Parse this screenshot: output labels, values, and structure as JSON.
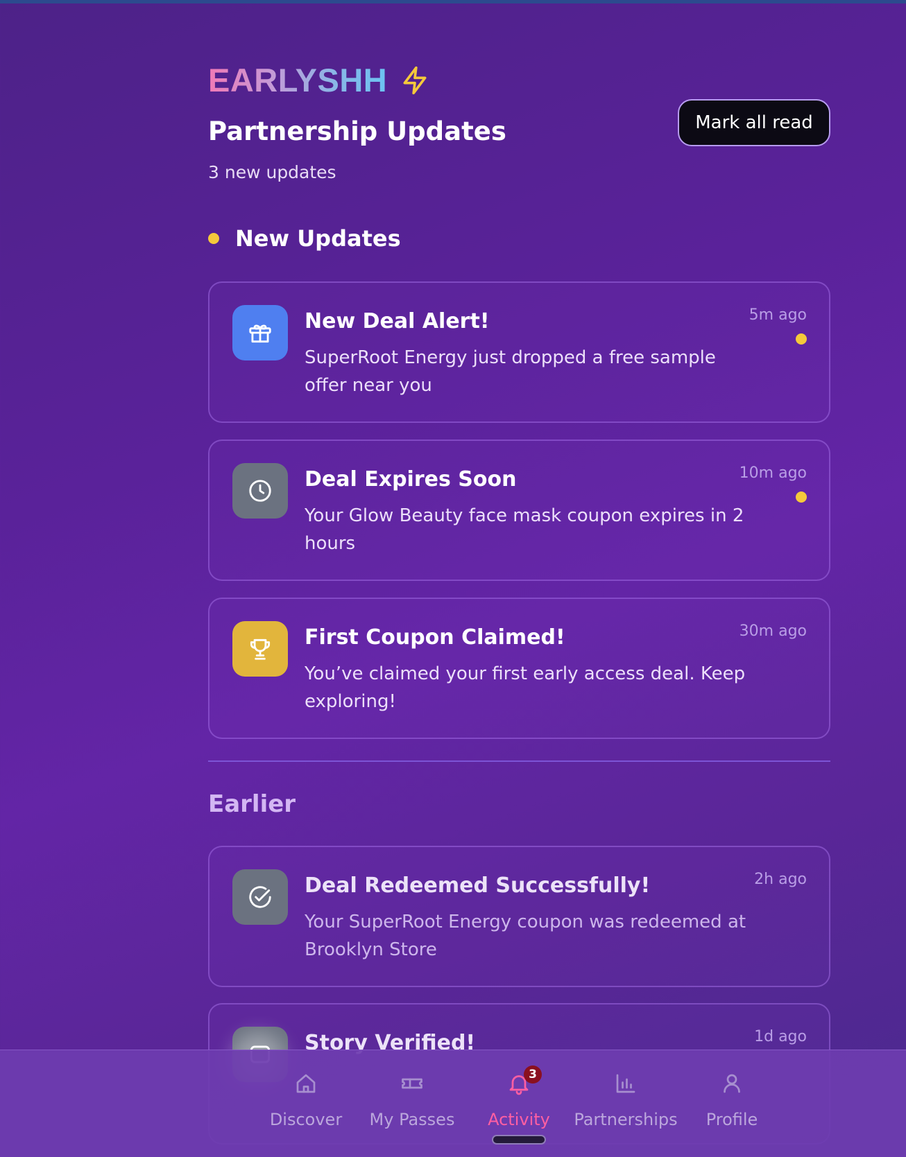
{
  "app": {
    "logo_text": "EARLYSHH",
    "logo_icon": "lightning-bolt-icon"
  },
  "header": {
    "title": "Partnership Updates",
    "subtitle": "3 new updates",
    "mark_all_label": "Mark all read"
  },
  "sections": {
    "new_title": "New Updates",
    "earlier_title": "Earlier"
  },
  "new_updates": [
    {
      "icon": "gift-icon",
      "icon_bg": "#4f7ff0",
      "title": "New Deal Alert!",
      "body": "SuperRoot Energy just dropped a free sample offer near you",
      "time": "5m ago",
      "unread": true
    },
    {
      "icon": "clock-icon",
      "icon_bg": "#6b7280",
      "title": "Deal Expires Soon",
      "body": "Your Glow Beauty face mask coupon expires in 2 hours",
      "time": "10m ago",
      "unread": true
    },
    {
      "icon": "trophy-icon",
      "icon_bg": "#e2b53c",
      "title": "First Coupon Claimed!",
      "body": "You’ve claimed your first early access deal. Keep exploring!",
      "time": "30m ago",
      "unread": false
    }
  ],
  "earlier_updates": [
    {
      "icon": "check-circle-icon",
      "icon_bg": "#6b7280",
      "title": "Deal Redeemed Successfully!",
      "body": "Your SuperRoot Energy coupon was redeemed at Brooklyn Store",
      "time": "2h ago"
    },
    {
      "icon": "badge-icon",
      "icon_bg": "#6b7280",
      "title": "Story Verified!",
      "body": "",
      "time": "1d ago"
    }
  ],
  "nav": {
    "items": [
      {
        "label": "Discover",
        "icon": "home-icon"
      },
      {
        "label": "My Passes",
        "icon": "ticket-icon"
      },
      {
        "label": "Activity",
        "icon": "bell-icon",
        "badge": "3",
        "active": true
      },
      {
        "label": "Partnerships",
        "icon": "bar-chart-icon"
      },
      {
        "label": "Profile",
        "icon": "user-icon"
      }
    ]
  },
  "colors": {
    "accent_yellow": "#f5c93b",
    "active_pink": "#ff5fa2"
  }
}
